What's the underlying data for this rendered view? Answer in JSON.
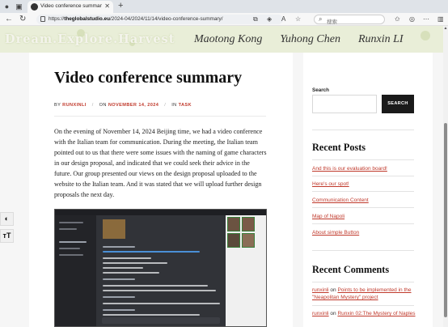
{
  "browser": {
    "tab_title": "Video conference summary - Dre…",
    "url_prefix": "https://",
    "url_domain": "theglobalstudio.eu",
    "url_path": "/2024-04/2024/11/14/video-conference-summary/",
    "search_placeholder": "搜索"
  },
  "banner": {
    "logo": "Dream.Explore.Harvest",
    "authors": [
      "Maotong Kong",
      "Yuhong Chen",
      "Runxin LI"
    ]
  },
  "post": {
    "title": "Video conference summary",
    "meta": {
      "by_label": "BY",
      "author": "RUNXINLI",
      "on_label": "ON",
      "date": "NOVEMBER 14, 2024",
      "in_label": "IN",
      "category": "TASK"
    },
    "body": "On the evening of November 14, 2024 Beijing time, we had a video conference with the Italian team for communication. During the meeting, the Italian team pointed out to us that there were some issues with the naming of game characters in our design proposal, and indicated that we could seek their advice in the future. Our group presented our views on the design proposal uploaded to the website to the Italian team. And it was stated that we will upload further design proposals the next day."
  },
  "a11y": {
    "contrast_icon": "contrast-icon",
    "font_size_label": "тT"
  },
  "sidebar": {
    "search_label": "Search",
    "search_button": "SEARCH",
    "recent_posts_heading": "Recent Posts",
    "recent_posts": [
      "And this is our evaluation board!",
      "Here's our spot!",
      "Communication Content",
      "Map of Napoli",
      "About simple Button"
    ],
    "recent_comments_heading": "Recent Comments",
    "recent_comments": [
      {
        "author": "runxinli",
        "on": " on ",
        "post": "Points to be implemented in the \"Neapolitan Mystery\" project"
      },
      {
        "author": "runxinli",
        "on": " on ",
        "post": "Runxin 02:The Mystery of Naples"
      }
    ]
  },
  "colors": {
    "accent": "#c0392b",
    "banner_bg": "#e9eed8",
    "search_button_bg": "#1a1a1a"
  }
}
